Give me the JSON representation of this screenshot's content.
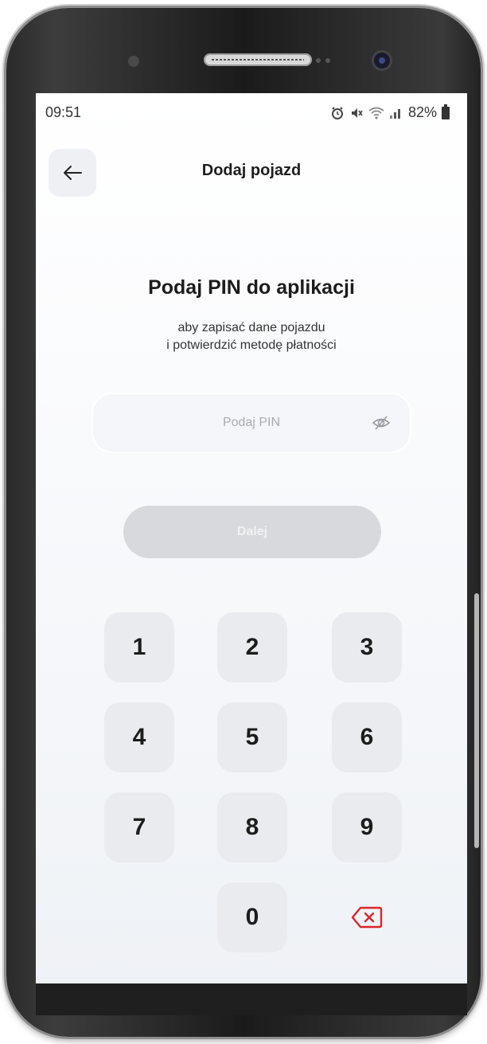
{
  "status_bar": {
    "time": "09:51",
    "battery": "82%",
    "icons": [
      "alarm-icon",
      "mute-icon",
      "wifi-icon",
      "signal-icon",
      "battery-icon"
    ]
  },
  "header": {
    "title": "Dodaj pojazd",
    "back_icon": "arrow-left-icon"
  },
  "main": {
    "heading": "Podaj PIN do aplikacji",
    "subtitle_line1": "aby zapisać dane pojazdu",
    "subtitle_line2": "i potwierdzić metodę płatności",
    "pin_input": {
      "placeholder": "Podaj PIN",
      "value": "",
      "toggle_icon": "eye-off-icon"
    },
    "next_button": {
      "label": "Dalej",
      "disabled": true
    }
  },
  "keypad": {
    "keys": [
      "1",
      "2",
      "3",
      "4",
      "5",
      "6",
      "7",
      "8",
      "9",
      "0"
    ],
    "delete_icon": "backspace-icon"
  },
  "colors": {
    "accent_delete": "#d9252a",
    "button_disabled": "#d8d9dc",
    "key_background": "#e9ebef"
  }
}
